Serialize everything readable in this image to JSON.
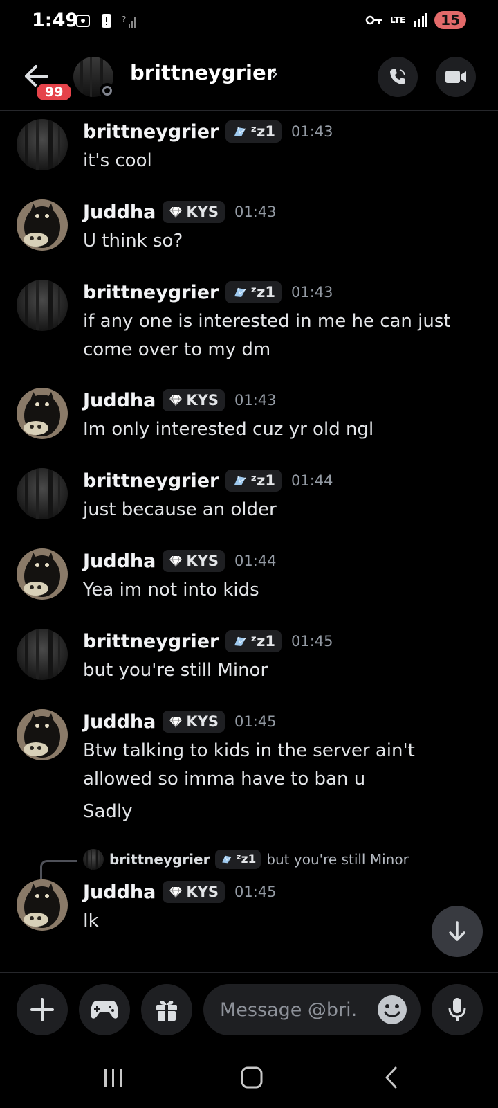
{
  "status_bar": {
    "time": "1:49",
    "network": "LTE",
    "battery": "15"
  },
  "header": {
    "unread_badge": "99",
    "channel_name": "brittneygrier",
    "chevron": "›"
  },
  "messages": [
    {
      "author": "brittneygrier",
      "tag": "ᶻz1",
      "time": "01:43",
      "lines": [
        "it's cool"
      ]
    },
    {
      "author": "Juddha",
      "tag": "KYS",
      "time": "01:43",
      "lines": [
        "U think so?"
      ]
    },
    {
      "author": "brittneygrier",
      "tag": "ᶻz1",
      "time": "01:43",
      "lines": [
        "if any one is interested in me he can just",
        "come over to my dm"
      ]
    },
    {
      "author": "Juddha",
      "tag": "KYS",
      "time": "01:43",
      "lines": [
        "Im only interested cuz yr old ngl"
      ]
    },
    {
      "author": "brittneygrier",
      "tag": "ᶻz1",
      "time": "01:44",
      "lines": [
        "just because an older"
      ]
    },
    {
      "author": "Juddha",
      "tag": "KYS",
      "time": "01:44",
      "lines": [
        "Yea im not into kids"
      ]
    },
    {
      "author": "brittneygrier",
      "tag": "ᶻz1",
      "time": "01:45",
      "lines": [
        "but you're still  Minor"
      ]
    },
    {
      "author": "Juddha",
      "tag": "KYS",
      "time": "01:45",
      "lines": [
        "Btw talking to kids in the server ain't",
        "allowed so imma have to ban u"
      ],
      "followup": "Sadly"
    },
    {
      "author": "Juddha",
      "tag": "KYS",
      "time": "01:45",
      "lines": [
        "Ik"
      ],
      "reply": {
        "author": "brittneygrier",
        "tag": "ᶻz1",
        "text": "but you're still  Minor"
      }
    }
  ],
  "composer": {
    "placeholder": "Message @bri..."
  },
  "colors": {
    "background": "#000000",
    "badge": "#e5434a",
    "muted_text": "#949ba4",
    "button_bg": "#1e1f22"
  }
}
